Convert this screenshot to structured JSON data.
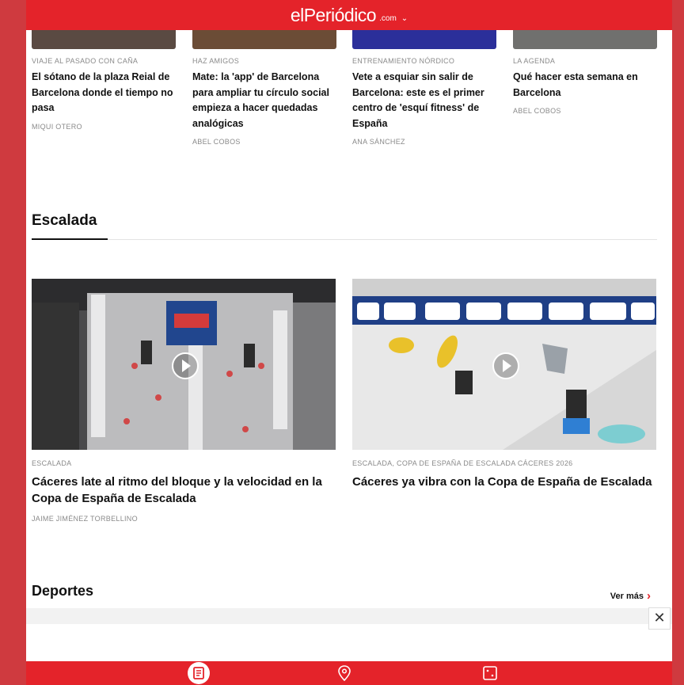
{
  "header": {
    "brand": "elPeriódico",
    "suffix": ".com",
    "caret": "⌄"
  },
  "top_articles": [
    {
      "category": "VIAJE AL PASADO CON CAÑA",
      "title": "El sótano de la plaza Reial de Barcelona donde el tiempo no pasa",
      "author": "MIQUI OTERO",
      "thumb_color": "#5a4a42"
    },
    {
      "category": "HAZ AMIGOS",
      "title": "Mate: la 'app' de Barcelona para ampliar tu círculo social empieza a hacer quedadas analógicas",
      "author": "ABEL COBOS",
      "thumb_color": "#6b4c36"
    },
    {
      "category": "ENTRENAMIENTO NÓRDICO",
      "title": "Vete a esquiar sin salir de Barcelona: este es el primer centro de 'esquí fitness' de España",
      "author": "ANA SÁNCHEZ",
      "thumb_color": "#2b2f9a"
    },
    {
      "category": "LA AGENDA",
      "title": "Qué hacer esta semana en Barcelona",
      "author": "ABEL COBOS",
      "thumb_color": "#70706e"
    }
  ],
  "escalada": {
    "section_title": "Escalada",
    "articles": [
      {
        "category": "ESCALADA",
        "title": "Cáceres late al ritmo del bloque y la velocidad en la Copa de España de Escalada",
        "author": "JAIME JIMÉNEZ TORBELLINO"
      },
      {
        "category": "ESCALADA, COPA DE ESPAÑA DE ESCALADA CÁCERES 2026",
        "title": "Cáceres ya vibra con la Copa de España de Escalada",
        "author": ""
      }
    ]
  },
  "deportes": {
    "section_title": "Deportes",
    "more_label": "Ver más"
  },
  "ad": {
    "close_label": "✕"
  },
  "colors": {
    "brand_red": "#e4232a",
    "frame_red": "#cf3a3f"
  }
}
